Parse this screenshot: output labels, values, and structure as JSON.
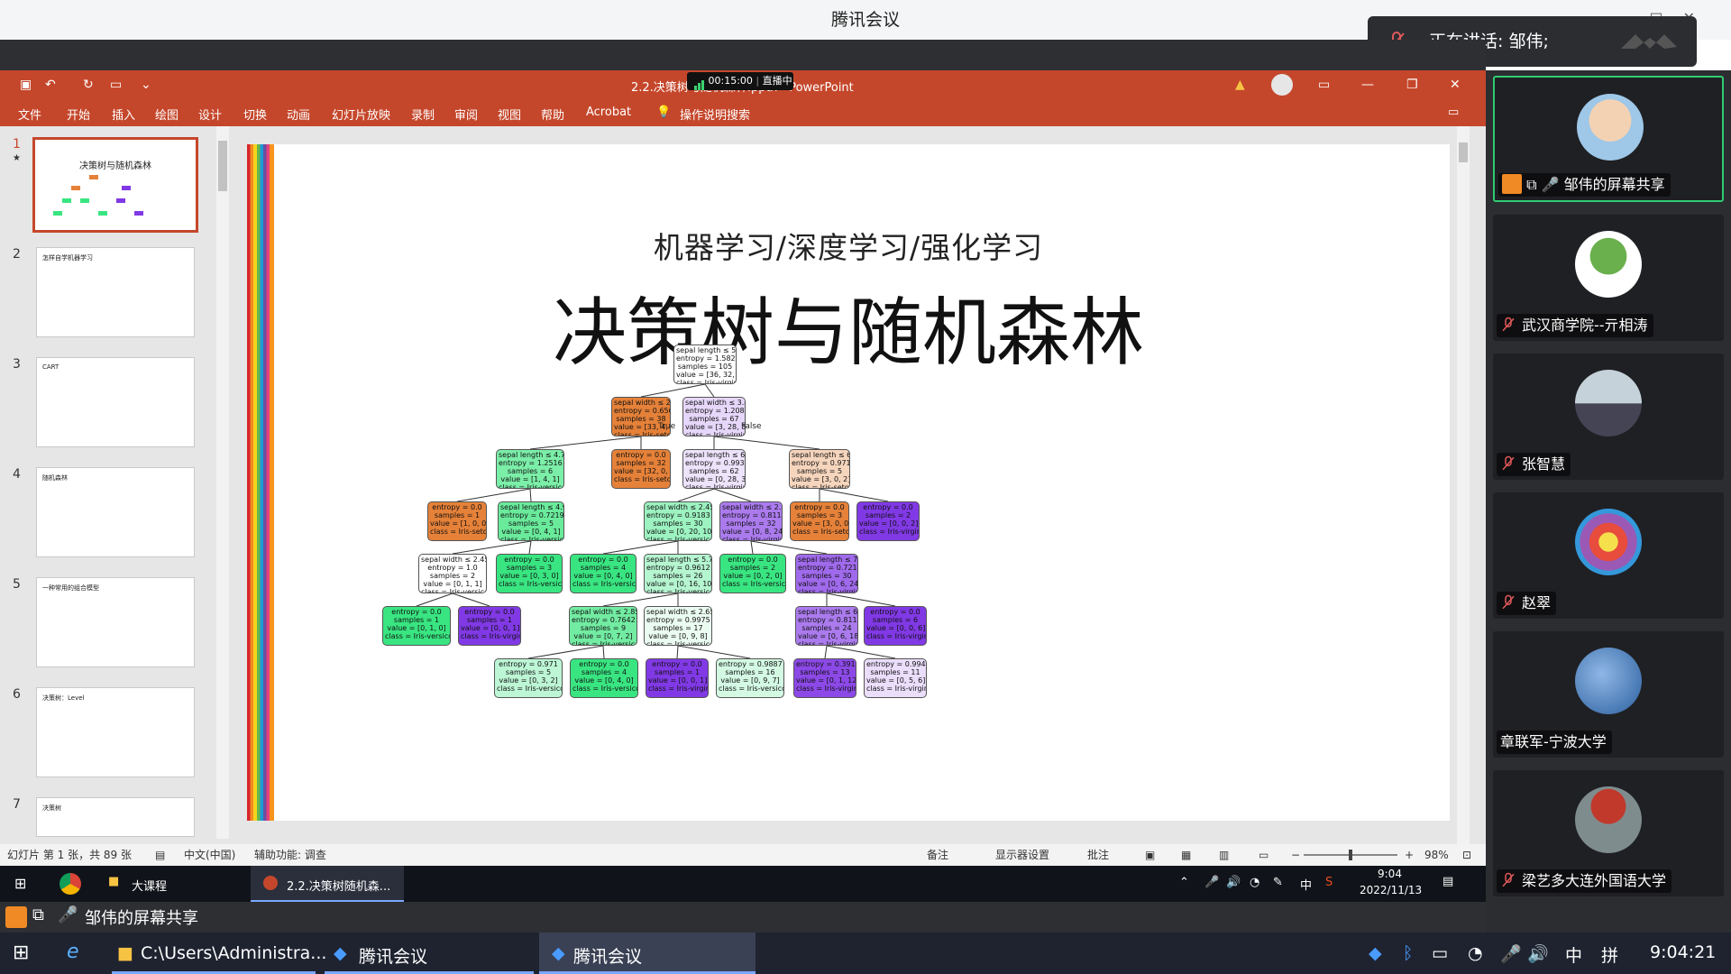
{
  "meeting": {
    "app_title": "腾讯会议",
    "speaking_label": "正在讲话: 邹伟;"
  },
  "ppt": {
    "filename": "2.2.决策树与随机森林.pptx - PowerPoint",
    "rec_time": "00:15:00",
    "rec_status": "直播中",
    "tabs": [
      "文件",
      "开始",
      "插入",
      "绘图",
      "设计",
      "切换",
      "动画",
      "幻灯片放映",
      "录制",
      "审阅",
      "视图",
      "帮助",
      "Acrobat"
    ],
    "tell_me": "操作说明搜索",
    "thumbnails": [
      {
        "num": "1",
        "title": "决策树与随机森林",
        "selected": true
      },
      {
        "num": "2",
        "title": "怎样自学机器学习",
        "selected": false
      },
      {
        "num": "3",
        "title": "CART",
        "selected": false
      },
      {
        "num": "4",
        "title": "随机森林",
        "selected": false
      },
      {
        "num": "5",
        "title": "一种常用的组合模型",
        "selected": false
      },
      {
        "num": "6",
        "title": "决策树：Level",
        "selected": false
      },
      {
        "num": "7",
        "title": "决策树",
        "selected": false
      }
    ],
    "slide": {
      "subtitle": "机器学习/深度学习/强化学习",
      "title": "决策树与随机森林",
      "true_label": "True",
      "false_label": "False",
      "tree_nodes": [
        {
          "id": "root",
          "lines": [
            "sepal length ≤ 5.45",
            "entropy = 1.5822",
            "samples = 105",
            "value = [36, 32, 37]",
            "class = Iris-virginica"
          ],
          "color": "#ffffff"
        },
        {
          "id": "n1",
          "lines": [
            "sepal width ≤ 2.8",
            "entropy = 0.6567",
            "samples = 38",
            "value = [33, 4, 1]",
            "class = Iris-setosa"
          ],
          "color": "#e58139"
        },
        {
          "id": "n2",
          "lines": [
            "sepal width ≤ 3.45",
            "entropy = 1.2082",
            "samples = 67",
            "value = [3, 28, 36]",
            "class = Iris-virginica"
          ],
          "color": "#e6d7fa"
        },
        {
          "id": "n3",
          "lines": [
            "sepal length ≤ 4.7",
            "entropy = 1.2516",
            "samples = 6",
            "value = [1, 4, 1]",
            "class = Iris-versicolor"
          ],
          "color": "#7beea8"
        },
        {
          "id": "n4",
          "lines": [
            "entropy = 0.0",
            "samples = 32",
            "value = [32, 0, 0]",
            "class = Iris-setosa"
          ],
          "color": "#e58139"
        },
        {
          "id": "n5",
          "lines": [
            "sepal length ≤ 6.25",
            "entropy = 0.9932",
            "samples = 62",
            "value = [0, 28, 34]",
            "class = Iris-virginica"
          ],
          "color": "#ede3fb"
        },
        {
          "id": "n6",
          "lines": [
            "sepal length ≤ 6.45",
            "entropy = 0.971",
            "samples = 5",
            "value = [3, 0, 2]",
            "class = Iris-setosa"
          ],
          "color": "#f6d5bd"
        },
        {
          "id": "n7",
          "lines": [
            "entropy = 0.0",
            "samples = 1",
            "value = [1, 0, 0]",
            "class = Iris-setosa"
          ],
          "color": "#e58139"
        },
        {
          "id": "n8",
          "lines": [
            "sepal length ≤ 4.95",
            "entropy = 0.7219",
            "samples = 5",
            "value = [0, 4, 1]",
            "class = Iris-versicolor"
          ],
          "color": "#6aeb9c"
        },
        {
          "id": "n9",
          "lines": [
            "sepal width ≤ 2.45",
            "entropy = 0.9183",
            "samples = 30",
            "value = [0, 20, 10]",
            "class = Iris-versicolor"
          ],
          "color": "#9cf2c0"
        },
        {
          "id": "n10",
          "lines": [
            "sepal width ≤ 2.55",
            "entropy = 0.8113",
            "samples = 32",
            "value = [0, 8, 24]",
            "class = Iris-virginica"
          ],
          "color": "#ab7bee"
        },
        {
          "id": "n11",
          "lines": [
            "entropy = 0.0",
            "samples = 3",
            "value = [3, 0, 0]",
            "class = Iris-setosa"
          ],
          "color": "#e58139"
        },
        {
          "id": "n12",
          "lines": [
            "entropy = 0.0",
            "samples = 2",
            "value = [0, 0, 2]",
            "class = Iris-virginica"
          ],
          "color": "#8139e5"
        },
        {
          "id": "n13",
          "lines": [
            "sepal width ≤ 2.45",
            "entropy = 1.0",
            "samples = 2",
            "value = [0, 1, 1]",
            "class = Iris-versicolor"
          ],
          "color": "#ffffff"
        },
        {
          "id": "n14",
          "lines": [
            "entropy = 0.0",
            "samples = 3",
            "value = [0, 3, 0]",
            "class = Iris-versicolor"
          ],
          "color": "#39e581"
        },
        {
          "id": "n15",
          "lines": [
            "entropy = 0.0",
            "samples = 4",
            "value = [0, 4, 0]",
            "class = Iris-versicolor"
          ],
          "color": "#39e581"
        },
        {
          "id": "n16",
          "lines": [
            "sepal length ≤ 5.75",
            "entropy = 0.9612",
            "samples = 26",
            "value = [0, 16, 10]",
            "class = Iris-versicolor"
          ],
          "color": "#b5f5d0"
        },
        {
          "id": "n17",
          "lines": [
            "entropy = 0.0",
            "samples = 2",
            "value = [0, 2, 0]",
            "class = Iris-versicolor"
          ],
          "color": "#39e581"
        },
        {
          "id": "n18",
          "lines": [
            "sepal length ≤ 7.1",
            "entropy = 0.7219",
            "samples = 30",
            "value = [0, 6, 24]",
            "class = Iris-virginica"
          ],
          "color": "#a06aec"
        },
        {
          "id": "n19",
          "lines": [
            "entropy = 0.0",
            "samples = 1",
            "value = [0, 1, 0]",
            "class = Iris-versicolor"
          ],
          "color": "#39e581"
        },
        {
          "id": "n20",
          "lines": [
            "entropy = 0.0",
            "samples = 1",
            "value = [0, 0, 1]",
            "class = Iris-virginica"
          ],
          "color": "#8139e5"
        },
        {
          "id": "n21",
          "lines": [
            "sepal width ≤ 2.85",
            "entropy = 0.7642",
            "samples = 9",
            "value = [0, 7, 2]",
            "class = Iris-versicolor"
          ],
          "color": "#72ec a2"
        },
        {
          "id": "n22",
          "lines": [
            "sepal width ≤ 2.65",
            "entropy = 0.9975",
            "samples = 17",
            "value = [0, 9, 8]",
            "class = Iris-versicolor"
          ],
          "color": "#ebfcf2"
        },
        {
          "id": "n23",
          "lines": [
            "sepal length ≤ 6.6",
            "entropy = 0.8113",
            "samples = 24",
            "value = [0, 6, 18]",
            "class = Iris-virginica"
          ],
          "color": "#ab7bee"
        },
        {
          "id": "n24",
          "lines": [
            "entropy = 0.0",
            "samples = 6",
            "value = [0, 0, 6]",
            "class = Iris-virginica"
          ],
          "color": "#8139e5"
        },
        {
          "id": "n25",
          "lines": [
            "entropy = 0.971",
            "samples = 5",
            "value = [0, 3, 2]",
            "class = Iris-versicolor"
          ],
          "color": "#bdf6d5"
        },
        {
          "id": "n26",
          "lines": [
            "entropy = 0.0",
            "samples = 4",
            "value = [0, 4, 0]",
            "class = Iris-versicolor"
          ],
          "color": "#39e581"
        },
        {
          "id": "n27",
          "lines": [
            "entropy = 0.0",
            "samples = 1",
            "value = [0, 0, 1]",
            "class = Iris-virginica"
          ],
          "color": "#8139e5"
        },
        {
          "id": "n28",
          "lines": [
            "entropy = 0.9887",
            "samples = 16",
            "value = [0, 9, 7]",
            "class = Iris-versicolor"
          ],
          "color": "#d3f9e3"
        },
        {
          "id": "n29",
          "lines": [
            "entropy = 0.3912",
            "samples = 13",
            "value = [0, 1, 12]",
            "class = Iris-virginica"
          ],
          "color": "#8c49e7"
        },
        {
          "id": "n30",
          "lines": [
            "entropy = 0.994",
            "samples = 11",
            "value = [0, 5, 6]",
            "class = Iris-virginica"
          ],
          "color": "#eadefb"
        }
      ]
    },
    "status": {
      "slide_info": "幻灯片 第 1 张，共 89 张",
      "language": "中文(中国)",
      "accessibility": "辅助功能: 调查",
      "notes": "备注",
      "display_settings": "显示器设置",
      "comments": "批注",
      "zoom": "98%"
    }
  },
  "inner_taskbar": {
    "folder_label": "大课程",
    "ppt_label": "2.2.决策树随机森...",
    "ime": "中",
    "time": "9:04",
    "date": "2022/11/13"
  },
  "share_bar": {
    "label": "邹伟的屏幕共享"
  },
  "outer_taskbar": {
    "explorer_label": "C:\\Users\\Administra...",
    "meeting_label_1": "腾讯会议",
    "meeting_label_2": "腾讯会议",
    "ime": "中",
    "time": "9:04:21"
  },
  "participants": [
    {
      "name": "邹伟的屏幕共享",
      "active": true
    },
    {
      "name": "武汉商学院--亓相涛",
      "active": false
    },
    {
      "name": "张智慧",
      "active": false
    },
    {
      "name": "赵翠",
      "active": false
    },
    {
      "name": "章联军-宁波大学",
      "active": false
    },
    {
      "name": "梁艺多大连外国语大学",
      "active": false
    }
  ]
}
